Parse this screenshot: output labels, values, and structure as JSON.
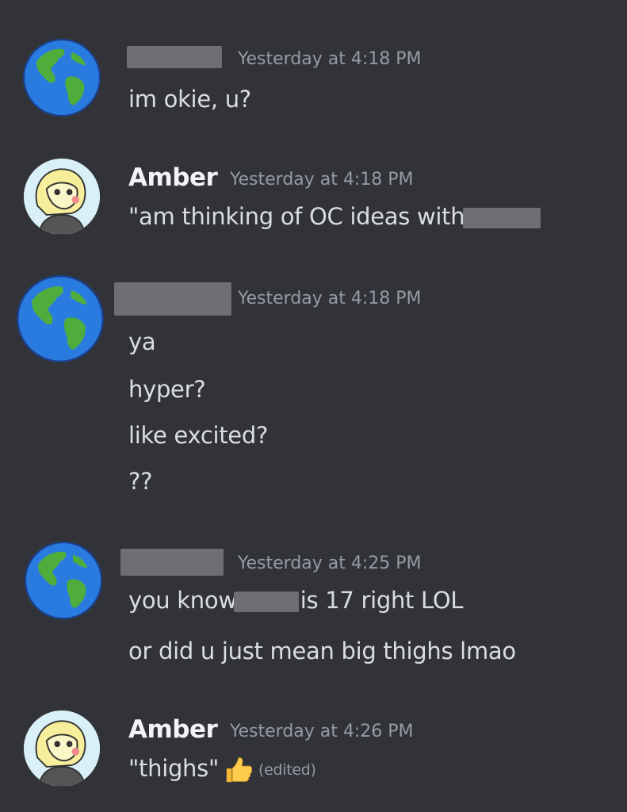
{
  "messages": [
    {
      "author": "",
      "avatar": "globe-icon",
      "timestamp": "Yesterday at 4:18 PM",
      "lines": [
        "im okie, u?"
      ]
    },
    {
      "author": "Amber",
      "avatar": "drawn-character-avatar",
      "timestamp": "Yesterday at 4:18 PM",
      "lines": [
        "\"am thinking of OC ideas with"
      ]
    },
    {
      "author": "",
      "avatar": "globe-icon",
      "timestamp": "Yesterday at 4:18 PM",
      "lines": [
        "ya",
        "hyper?",
        "like excited?",
        "??"
      ]
    },
    {
      "author": "",
      "avatar": "globe-icon",
      "timestamp": "Yesterday at 4:25 PM",
      "lines": [
        "you know",
        "is 17 right LOL",
        "or did u just mean big thighs lmao"
      ]
    },
    {
      "author": "Amber",
      "avatar": "drawn-character-avatar",
      "timestamp": "Yesterday at 4:26 PM",
      "lines": [
        "\"thighs\""
      ],
      "reaction_icon": "thumbs-up-icon",
      "edited_label": "(edited)"
    }
  ],
  "colors": {
    "background": "#313338",
    "author": "#f2f3f5",
    "text": "#dbdee1",
    "timestamp": "#949ba4",
    "redaction": "#6d6f73"
  }
}
